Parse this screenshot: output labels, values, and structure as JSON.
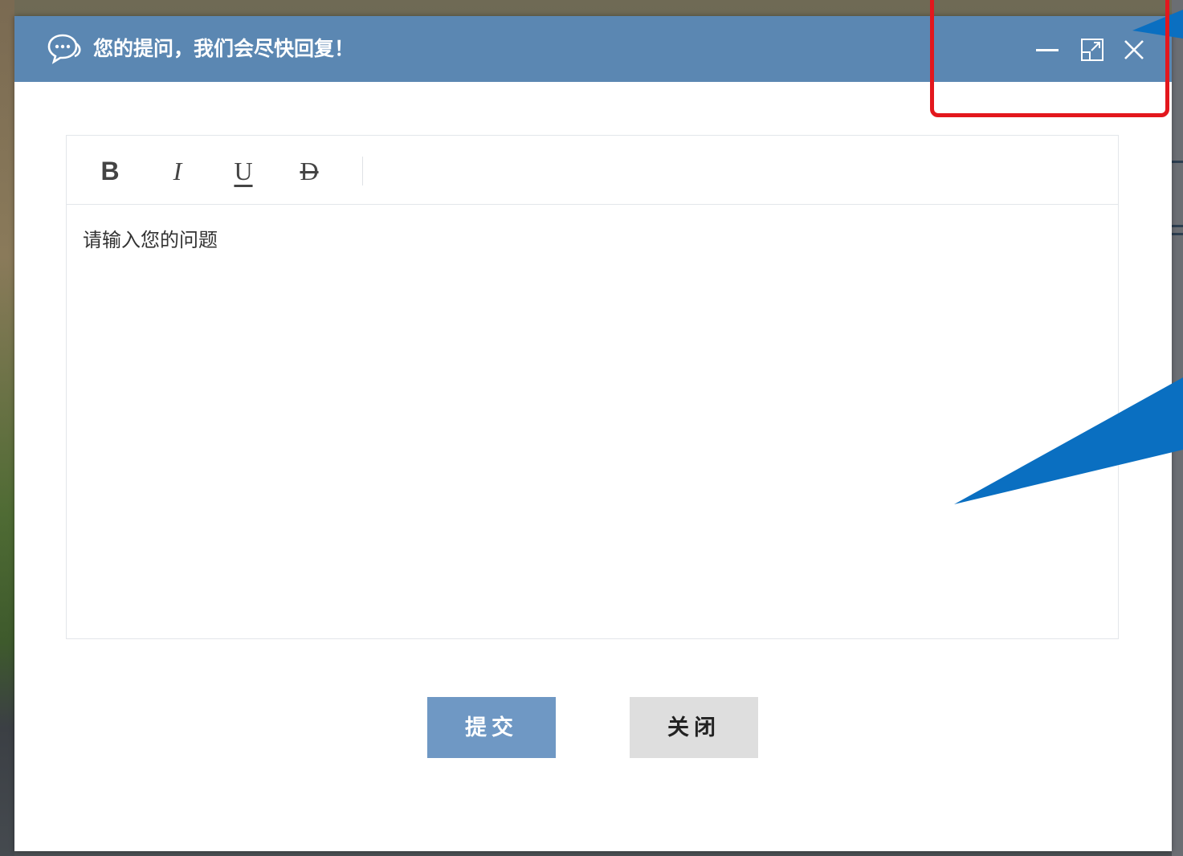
{
  "dialog": {
    "title": "您的提问，我们会尽快回复！",
    "icons": {
      "title_icon": "chat-bubble-icon",
      "minimize": "minimize-icon",
      "maximize": "maximize-icon",
      "close": "close-icon"
    }
  },
  "editor": {
    "toolbar": {
      "bold": "B",
      "italic": "I",
      "underline": "U",
      "strike": "D"
    },
    "placeholder": "请输入您的问题"
  },
  "buttons": {
    "submit": "提交",
    "close": "关闭"
  },
  "colors": {
    "titlebar": "#5b87b2",
    "submit": "#6f98c4",
    "close": "#dedede",
    "highlight": "#e3171d",
    "callout": "#0a6fc1"
  }
}
